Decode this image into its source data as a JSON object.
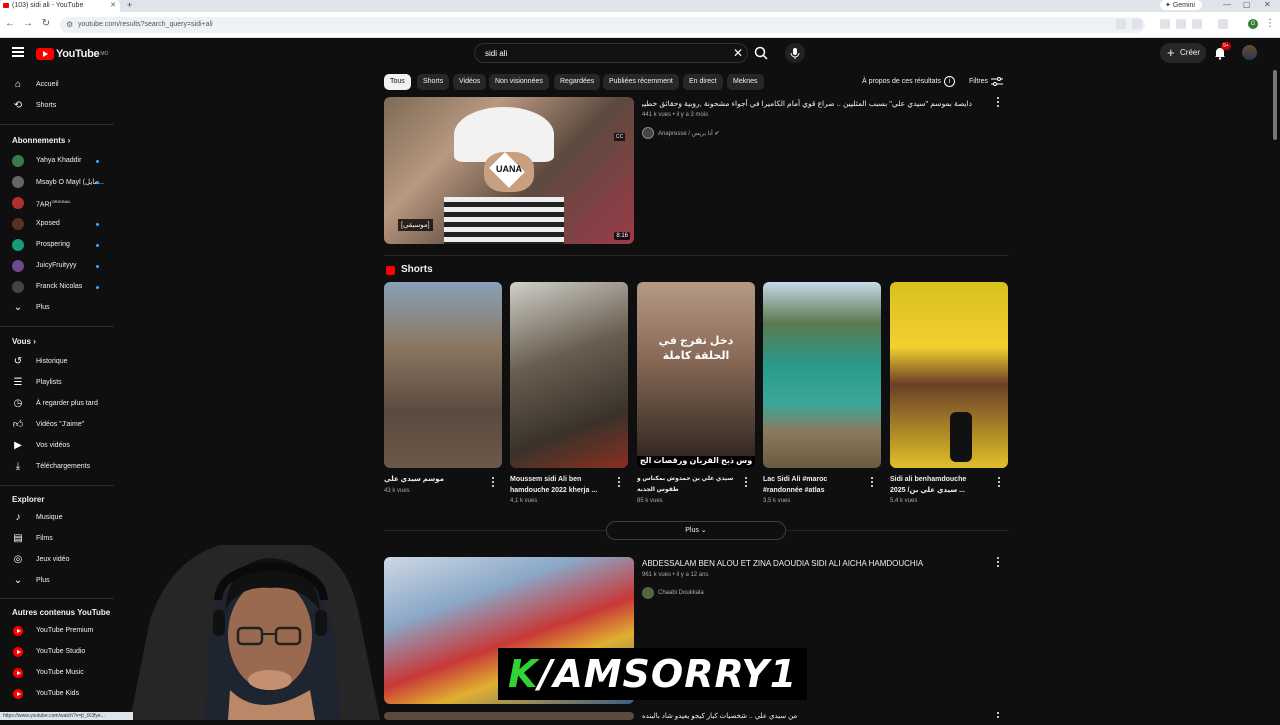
{
  "browser": {
    "tab_title": "(103) sidi ali - YouTube",
    "url": "youtube.com/results?search_query=sidi+ali",
    "gemini_label": "Gemini",
    "status_url": "https://www.youtube.com/watch?v=jt_tX3fye..."
  },
  "header": {
    "logo_text": "YouTube",
    "logo_sup": "MO",
    "search_value": "sidi ali",
    "create_label": "Créer",
    "notif_badge": "9+"
  },
  "sidebar": {
    "main": [
      {
        "label": "Accueil",
        "icon": "home-icon"
      },
      {
        "label": "Shorts",
        "icon": "shorts-icon"
      }
    ],
    "subs_title": "Abonnements",
    "subs": [
      {
        "label": "Yahya Khaddir",
        "color": "#3a7a4a"
      },
      {
        "label": "Msayb O Mayl (مايل...",
        "color": "#555"
      },
      {
        "label": "7ARI",
        "sup": "ORIGINAL",
        "color": "#b03030"
      },
      {
        "label": "Xposed",
        "color": "#553322"
      },
      {
        "label": "Prospering",
        "color": "#1a9a7a"
      },
      {
        "label": "JuicyFruityyy",
        "color": "#6a4a8a"
      },
      {
        "label": "Franck Nicolas",
        "color": "#444"
      },
      {
        "label": "Plus",
        "icon": "chevron-down-icon"
      }
    ],
    "you_title": "Vous",
    "you": [
      {
        "label": "Historique"
      },
      {
        "label": "Playlists"
      },
      {
        "label": "À regarder plus tard"
      },
      {
        "label": "Vidéos \"J'aime\""
      },
      {
        "label": "Vos vidéos"
      },
      {
        "label": "Téléchargements"
      }
    ],
    "explore_title": "Explorer",
    "explore": [
      {
        "label": "Musique"
      },
      {
        "label": "Films"
      },
      {
        "label": "Jeux vidéo"
      },
      {
        "label": "Plus"
      }
    ],
    "other_title": "Autres contenus YouTube",
    "other": [
      {
        "label": "YouTube Premium"
      },
      {
        "label": "YouTube Studio"
      },
      {
        "label": "YouTube Music"
      },
      {
        "label": "YouTube Kids"
      }
    ]
  },
  "chips": [
    "Tous",
    "Shorts",
    "Vidéos",
    "Non visionnées",
    "Regardées",
    "Publiées récemment",
    "En direct",
    "Meknes"
  ],
  "about_label": "À propos de ces résultats",
  "filters_label": "Filtres",
  "video1": {
    "title": "دايصة بموسم \"سيدي علي\" بسبب المثليين .. صراع قوي أمام الكاميرا في أجواء مشحونة ,روبية وحقائق خطيرة",
    "meta": "441 k vues • il y a 3 mois",
    "channel": "Anapresse / أنا بريس",
    "duration": "8:16",
    "caption": "[موسيقى]",
    "logo": "UANA"
  },
  "shorts_title": "Shorts",
  "shorts": [
    {
      "title": "موسم سيدي علي",
      "title2": "",
      "views": "43 k vues"
    },
    {
      "title": "Moussem sidi Ali ben",
      "title2": "hamdouche 2022 kherja ...",
      "views": "4,1 k vues"
    },
    {
      "title": "سيدي علي بن حمدوش بمكناس و",
      "title2": "طقوس الجدبة",
      "views": "85 k vues",
      "overlay": "دخل تفرج في الحلقة كاملة",
      "banner": "وس ذبح القربان ورقصات الج"
    },
    {
      "title": "Lac Sidi Ali #maroc",
      "title2": "#randonnée #atlas",
      "views": "3,5 k vues"
    },
    {
      "title": "Sidi ali benhamdouche",
      "title2": "2025 /سيدي علي بن ...",
      "views": "5,4 k vues"
    }
  ],
  "more_label": "Plus",
  "video2": {
    "title": "ABDESSALAM BEN ALOU ET ZINA DAOUDIA SIDI ALI AICHA HAMDOUCHIA",
    "meta": "961 k vues • il y a 12 ans",
    "channel": "Chaabi Doukkala"
  },
  "video3_title": "من سيدي علي .. شخصيات كبار كيجو يعيدو شاد بالبنده",
  "overlay_text": "K/AMSORRY1"
}
